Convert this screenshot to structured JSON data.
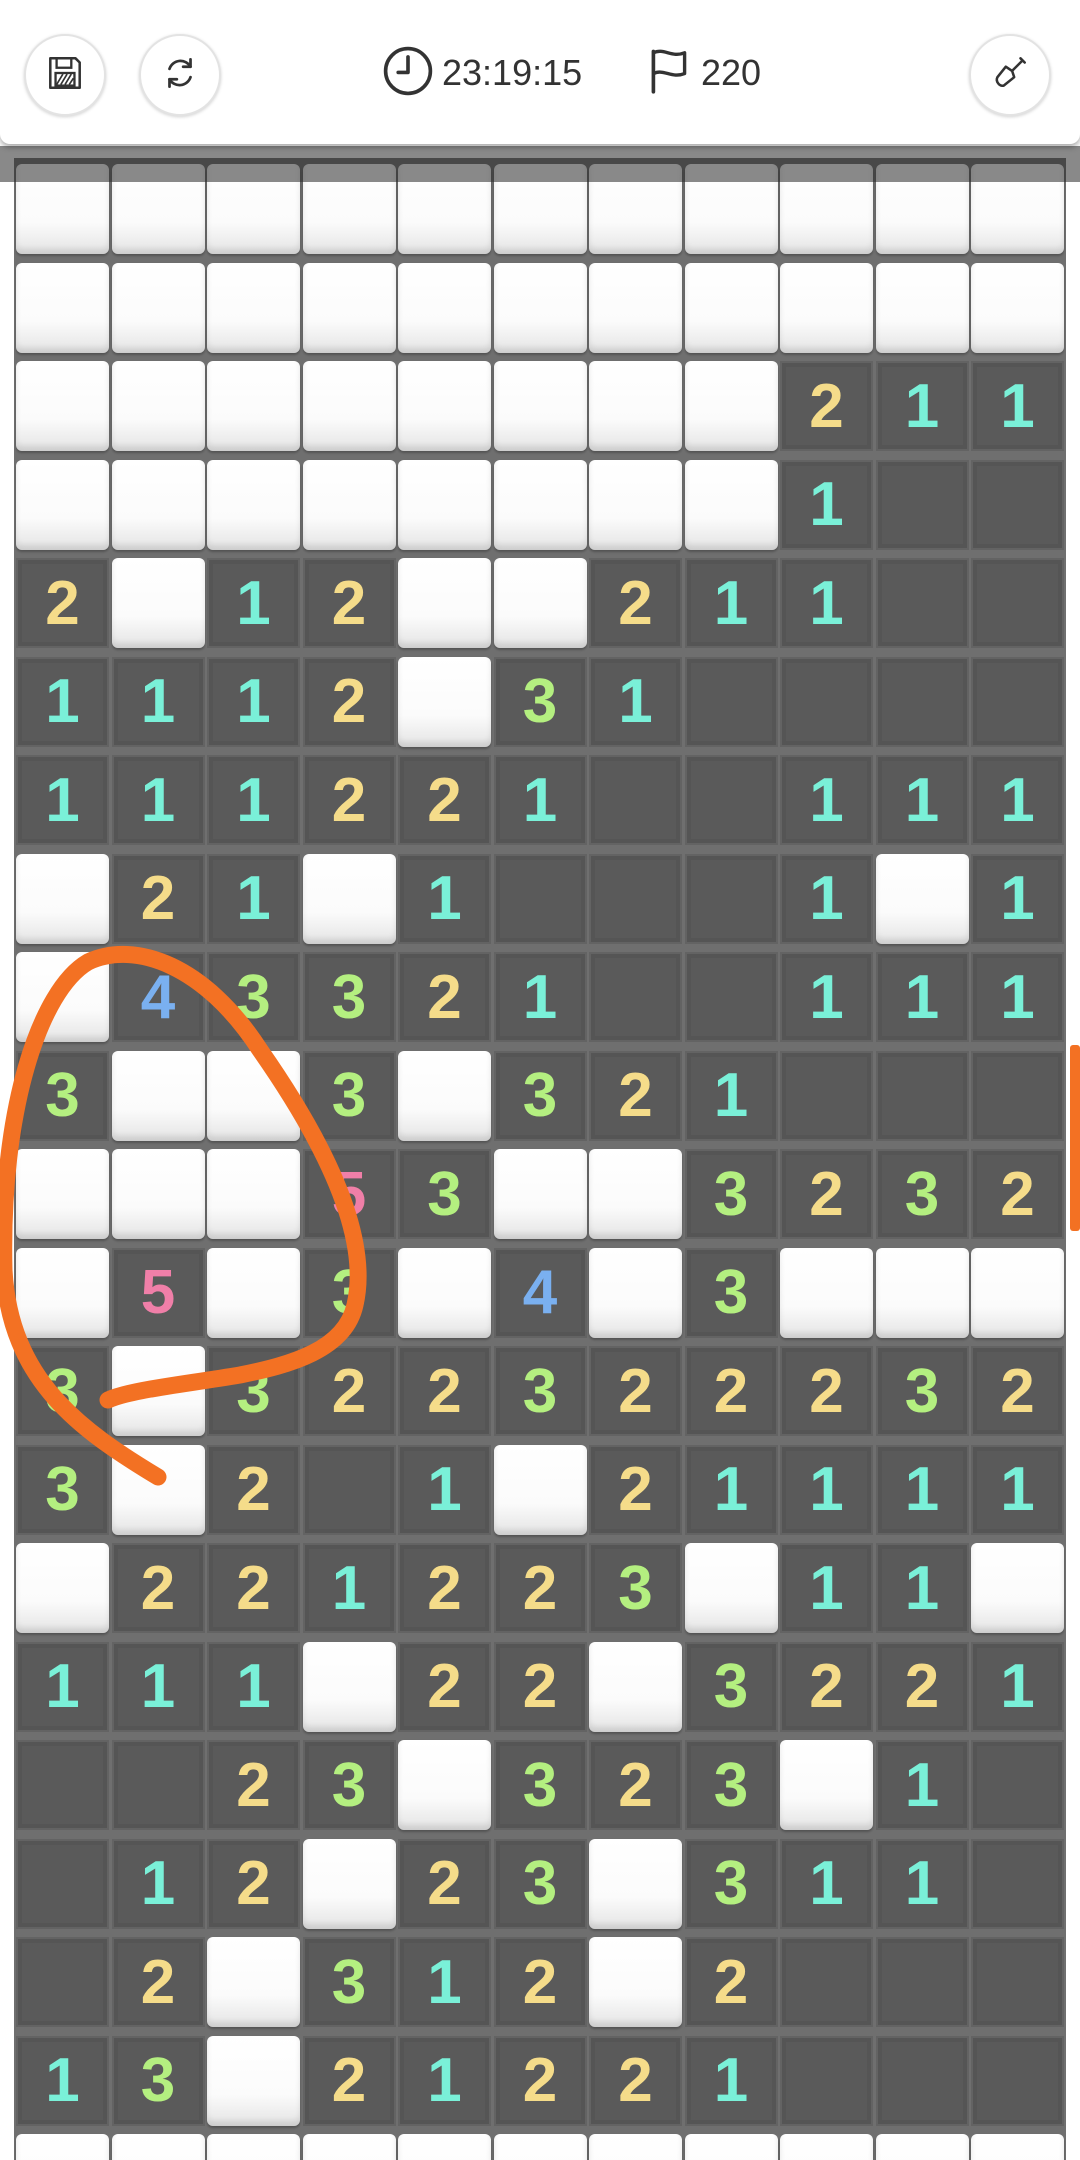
{
  "header": {
    "save_icon": "floppy-save-icon",
    "restart_icon": "refresh-icon",
    "timer_icon": "clock-icon",
    "timer": "23:19:15",
    "flag_icon": "flag-icon",
    "flags": "220",
    "tool_icon": "shovel-icon"
  },
  "colors": {
    "accent": "#f37123",
    "covered": "#ffffff",
    "revealed": "#5a5a5a",
    "n1": "#7af0d8",
    "n2": "#f5dc8a",
    "n3": "#b4ef80",
    "n4": "#7ab0f0",
    "n5": "#f07fa8"
  },
  "board": {
    "columns": 11,
    "legend": "C = covered tile, . = revealed empty tile, digit = revealed number",
    "rows": [
      "CCCCCCCCCCC",
      "CCCCCCCCCCC",
      "CCCCCCCC211",
      "CCCCCCCC1..",
      "2C12CC211..",
      "1112C31....",
      "111221..111",
      "C21C1...1C1",
      "C43321..111",
      "3CC3C321...",
      "CCC53CC3232",
      "C5C3C4C3CCC",
      "3C322322232",
      "3C2.1C21111",
      "C221223C11C",
      "111C22C3221",
      "..23C323C1.",
      ".12C23C311.",
      ".2C312C2...",
      "13C21221...",
      "CCCCCCCCCCC"
    ]
  }
}
